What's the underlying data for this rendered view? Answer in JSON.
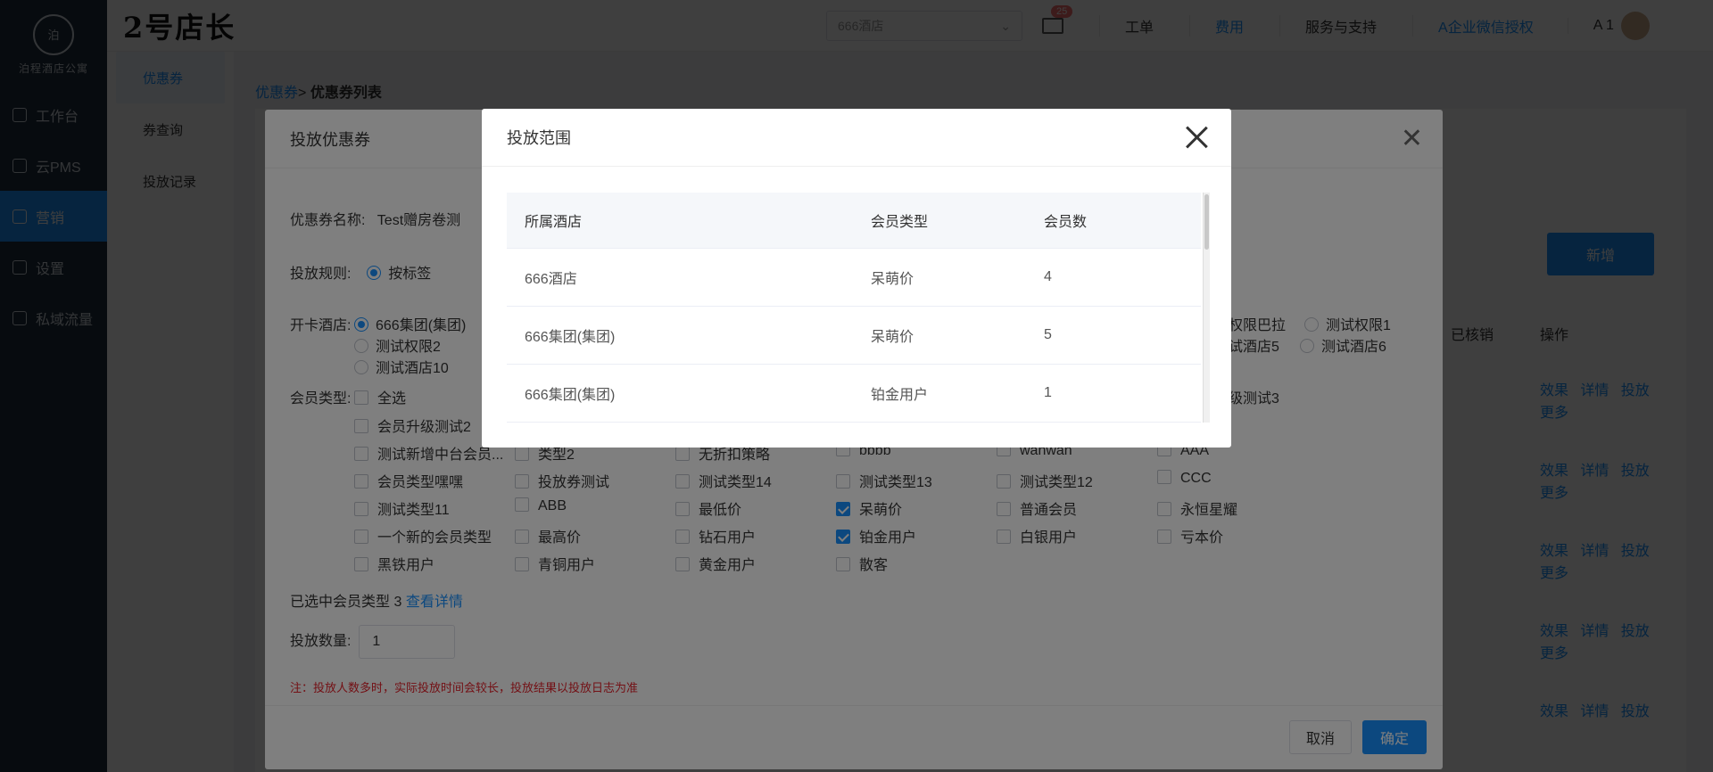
{
  "app": {
    "brand": "2号店长",
    "logo_text": "泊程酒店公寓"
  },
  "topbar": {
    "hotel_select_placeholder": "666酒店",
    "mail_badge": "25",
    "links": [
      "工单",
      "费用",
      "服务与支持",
      "A企业微信授权"
    ],
    "user_name": "A 1"
  },
  "sidebar": {
    "items": [
      "工作台",
      "云PMS",
      "营销",
      "设置",
      "私域流量"
    ],
    "active_index": 2
  },
  "subnav": {
    "items": [
      "优惠券",
      "券查询",
      "投放记录"
    ],
    "active_index": 0
  },
  "breadcrumb": {
    "parent": "优惠券",
    "separator": ">",
    "current": "优惠券列表"
  },
  "list": {
    "add_button": "新增",
    "col_redeemed": "已核销",
    "col_actions": "操作",
    "row_actions": [
      "效果",
      "详情",
      "投放",
      "更多"
    ]
  },
  "outer_dialog": {
    "title": "投放优惠券",
    "coupon_name_label": "优惠券名称:",
    "coupon_name_value": "Test赠房卷测",
    "rule_label": "投放规则:",
    "rule_option": "按标签",
    "hotel_label": "开卡酒店:",
    "hotels": [
      "666集团(集团)",
      "测试权限2",
      "测试酒店10",
      "权限巴拉",
      "测试权限1",
      "试酒店5",
      "测试酒店6"
    ],
    "member_type_label": "会员类型:",
    "select_all": "全选",
    "member_types": {
      "row0_right": "级测试3",
      "row1": [
        "会员升级测试2"
      ],
      "row2": [
        "测试新增中台会员...",
        "类型2",
        "无折扣策略",
        "bbbb",
        "wanwan",
        "AAA"
      ],
      "row3": [
        "会员类型嘿嘿",
        "投放券测试",
        "测试类型14",
        "测试类型13",
        "测试类型12",
        "CCC"
      ],
      "row4": [
        "测试类型11",
        "ABB",
        "最低价",
        "呆萌价",
        "普通会员",
        "永恒星耀"
      ],
      "row5": [
        "一个新的会员类型",
        "最高价",
        "钻石用户",
        "铂金用户",
        "白银用户",
        "亏本价"
      ],
      "row6": [
        "黑铁用户",
        "青铜用户",
        "黄金用户",
        "散客"
      ]
    },
    "selected_summary_prefix": "已选中会员类型",
    "selected_count": "3",
    "view_detail_link": "查看详情",
    "quantity_label": "投放数量:",
    "quantity_value": "1",
    "note": "注：投放人数多时，实际投放时间会较长，投放结果以投放日志为准",
    "cancel_button": "取消",
    "ok_button": "确定"
  },
  "inner_dialog": {
    "title": "投放范围",
    "columns": [
      "所属酒店",
      "会员类型",
      "会员数"
    ],
    "rows": [
      [
        "666酒店",
        "呆萌价",
        "4"
      ],
      [
        "666集团(集团)",
        "呆萌价",
        "5"
      ],
      [
        "666集团(集团)",
        "铂金用户",
        "1"
      ]
    ]
  },
  "colors": {
    "primary": "#1890ff",
    "sidebar_bg": "#1f2d3d",
    "danger": "#e6212a"
  }
}
